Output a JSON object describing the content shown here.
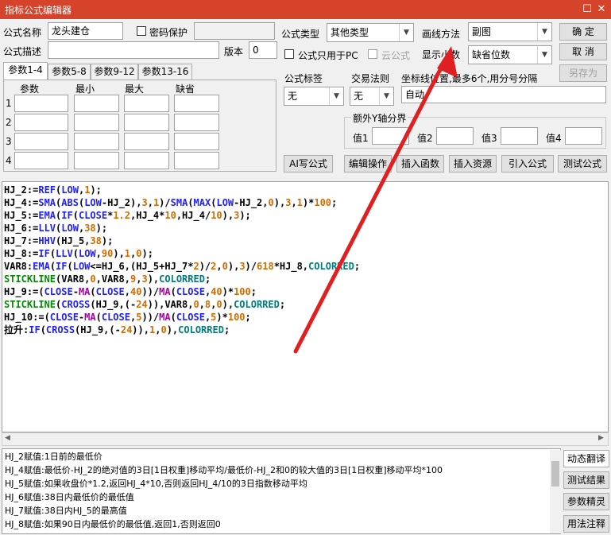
{
  "window": {
    "title": "指标公式编辑器",
    "restore_glyph": "☐",
    "close_glyph": "✕"
  },
  "form": {
    "name_label": "公式名称",
    "name_value": "龙头建仓",
    "password_label": "密码保护",
    "desc_label": "公式描述",
    "desc_value": "",
    "version_label": "版本",
    "version_value": "0",
    "type_label": "公式类型",
    "type_value": "其他类型",
    "draw_label": "画线方法",
    "draw_value": "副图",
    "pc_only_label": "公式只用于PC",
    "cloud_label": "云公式",
    "decimal_label": "显示小数",
    "decimal_value": "缺省位数",
    "formula_tag_label": "公式标签",
    "formula_tag_value": "无",
    "trade_rule_label": "交易法则",
    "trade_rule_value": "无",
    "axis_label": "坐标线位置,最多6个,用分号分隔",
    "axis_value": "自动",
    "extra_y_label": "额外Y轴分界",
    "val1_label": "值1",
    "val2_label": "值2",
    "val3_label": "值3",
    "val4_label": "值4"
  },
  "buttons": {
    "ok": "确  定",
    "cancel": "取  消",
    "save_as": "另存为",
    "ai_write": "AI写公式",
    "edit_ops": "编辑操作",
    "insert_func": "插入函数",
    "insert_res": "插入资源",
    "import": "引入公式",
    "test": "测试公式",
    "dyn_translate": "动态翻译",
    "test_result": "测试结果",
    "param_wizard": "参数精灵",
    "usage": "用法注释"
  },
  "tabs": [
    "参数1-4",
    "参数5-8",
    "参数9-12",
    "参数13-16"
  ],
  "params": {
    "headers": [
      "参数",
      "最小",
      "最大",
      "缺省"
    ],
    "rows": [
      "1",
      "2",
      "3",
      "4"
    ]
  },
  "code_lines": [
    [
      [
        "HJ_2:=",
        "k-black"
      ],
      [
        "REF",
        "k-blue"
      ],
      [
        "(",
        "k-black"
      ],
      [
        "LOW",
        "k-blue"
      ],
      [
        ",",
        "k-black"
      ],
      [
        "1",
        "k-org"
      ],
      [
        ");",
        "k-black"
      ]
    ],
    [
      [
        "HJ_4:=",
        "k-black"
      ],
      [
        "SMA",
        "k-blue"
      ],
      [
        "(",
        "k-black"
      ],
      [
        "ABS",
        "k-blue"
      ],
      [
        "(",
        "k-black"
      ],
      [
        "LOW",
        "k-blue"
      ],
      [
        "-HJ_2),",
        "k-black"
      ],
      [
        "3",
        "k-org"
      ],
      [
        ",",
        "k-black"
      ],
      [
        "1",
        "k-org"
      ],
      [
        ")/",
        "k-black"
      ],
      [
        "SMA",
        "k-blue"
      ],
      [
        "(",
        "k-black"
      ],
      [
        "MAX",
        "k-blue"
      ],
      [
        "(",
        "k-black"
      ],
      [
        "LOW",
        "k-blue"
      ],
      [
        "-HJ_2,",
        "k-black"
      ],
      [
        "0",
        "k-org"
      ],
      [
        "),",
        "k-black"
      ],
      [
        "3",
        "k-org"
      ],
      [
        ",",
        "k-black"
      ],
      [
        "1",
        "k-org"
      ],
      [
        ")*",
        "k-black"
      ],
      [
        "100",
        "k-org"
      ],
      [
        ";",
        "k-black"
      ]
    ],
    [
      [
        "HJ_5:=",
        "k-black"
      ],
      [
        "EMA",
        "k-blue"
      ],
      [
        "(",
        "k-black"
      ],
      [
        "IF",
        "k-blue"
      ],
      [
        "(",
        "k-black"
      ],
      [
        "CLOSE",
        "k-blue"
      ],
      [
        "*",
        "k-black"
      ],
      [
        "1.2",
        "k-org"
      ],
      [
        ",HJ_4*",
        "k-black"
      ],
      [
        "10",
        "k-org"
      ],
      [
        ",HJ_4/",
        "k-black"
      ],
      [
        "10",
        "k-org"
      ],
      [
        "),",
        "k-black"
      ],
      [
        "3",
        "k-org"
      ],
      [
        ");",
        "k-black"
      ]
    ],
    [
      [
        "HJ_6:=",
        "k-black"
      ],
      [
        "LLV",
        "k-blue"
      ],
      [
        "(",
        "k-black"
      ],
      [
        "LOW",
        "k-blue"
      ],
      [
        ",",
        "k-black"
      ],
      [
        "38",
        "k-org"
      ],
      [
        ");",
        "k-black"
      ]
    ],
    [
      [
        "HJ_7:=",
        "k-black"
      ],
      [
        "HHV",
        "k-blue"
      ],
      [
        "(HJ_5,",
        "k-black"
      ],
      [
        "38",
        "k-org"
      ],
      [
        ");",
        "k-black"
      ]
    ],
    [
      [
        "HJ_8:=",
        "k-black"
      ],
      [
        "IF",
        "k-blue"
      ],
      [
        "(",
        "k-black"
      ],
      [
        "LLV",
        "k-blue"
      ],
      [
        "(",
        "k-black"
      ],
      [
        "LOW",
        "k-blue"
      ],
      [
        ",",
        "k-black"
      ],
      [
        "90",
        "k-org"
      ],
      [
        "),",
        "k-black"
      ],
      [
        "1",
        "k-org"
      ],
      [
        ",",
        "k-black"
      ],
      [
        "0",
        "k-org"
      ],
      [
        ");",
        "k-black"
      ]
    ],
    [
      [
        "VAR8:",
        "k-black"
      ],
      [
        "EMA",
        "k-blue"
      ],
      [
        "(",
        "k-black"
      ],
      [
        "IF",
        "k-blue"
      ],
      [
        "(",
        "k-black"
      ],
      [
        "LOW",
        "k-blue"
      ],
      [
        "<=HJ_6,(HJ_5+HJ_7*",
        "k-black"
      ],
      [
        "2",
        "k-org"
      ],
      [
        ")/",
        "k-black"
      ],
      [
        "2",
        "k-org"
      ],
      [
        ",",
        "k-black"
      ],
      [
        "0",
        "k-org"
      ],
      [
        "),",
        "k-black"
      ],
      [
        "3",
        "k-org"
      ],
      [
        ")/",
        "k-black"
      ],
      [
        "618",
        "k-org"
      ],
      [
        "*HJ_8,",
        "k-black"
      ],
      [
        "COLORRED",
        "k-teal"
      ],
      [
        ";",
        "k-black"
      ]
    ],
    [
      [
        "STICKLINE",
        "k-green"
      ],
      [
        "(VAR8,",
        "k-black"
      ],
      [
        "0",
        "k-org"
      ],
      [
        ",VAR8,",
        "k-black"
      ],
      [
        "9",
        "k-org"
      ],
      [
        ",",
        "k-black"
      ],
      [
        "3",
        "k-org"
      ],
      [
        "),",
        "k-black"
      ],
      [
        "COLORRED",
        "k-teal"
      ],
      [
        ";",
        "k-black"
      ]
    ],
    [
      [
        "HJ_9:=(",
        "k-black"
      ],
      [
        "CLOSE",
        "k-blue"
      ],
      [
        "-",
        "k-black"
      ],
      [
        "MA",
        "k-pur"
      ],
      [
        "(",
        "k-black"
      ],
      [
        "CLOSE",
        "k-blue"
      ],
      [
        ",",
        "k-black"
      ],
      [
        "40",
        "k-org"
      ],
      [
        "))/",
        "k-black"
      ],
      [
        "MA",
        "k-pur"
      ],
      [
        "(",
        "k-black"
      ],
      [
        "CLOSE",
        "k-blue"
      ],
      [
        ",",
        "k-black"
      ],
      [
        "40",
        "k-org"
      ],
      [
        ")*",
        "k-black"
      ],
      [
        "100",
        "k-org"
      ],
      [
        ";",
        "k-black"
      ]
    ],
    [
      [
        "STICKLINE",
        "k-green"
      ],
      [
        "(",
        "k-black"
      ],
      [
        "CROSS",
        "k-blue"
      ],
      [
        "(HJ_9,(-",
        "k-black"
      ],
      [
        "24",
        "k-org"
      ],
      [
        ")),VAR8,",
        "k-black"
      ],
      [
        "0",
        "k-org"
      ],
      [
        ",",
        "k-black"
      ],
      [
        "8",
        "k-org"
      ],
      [
        ",",
        "k-black"
      ],
      [
        "0",
        "k-org"
      ],
      [
        "),",
        "k-black"
      ],
      [
        "COLORRED",
        "k-teal"
      ],
      [
        ";",
        "k-black"
      ]
    ],
    [
      [
        "HJ_10:=(",
        "k-black"
      ],
      [
        "CLOSE",
        "k-blue"
      ],
      [
        "-",
        "k-black"
      ],
      [
        "MA",
        "k-pur"
      ],
      [
        "(",
        "k-black"
      ],
      [
        "CLOSE",
        "k-blue"
      ],
      [
        ",",
        "k-black"
      ],
      [
        "5",
        "k-org"
      ],
      [
        "))/",
        "k-black"
      ],
      [
        "MA",
        "k-pur"
      ],
      [
        "(",
        "k-black"
      ],
      [
        "CLOSE",
        "k-blue"
      ],
      [
        ",",
        "k-black"
      ],
      [
        "5",
        "k-org"
      ],
      [
        ")*",
        "k-black"
      ],
      [
        "100",
        "k-org"
      ],
      [
        ";",
        "k-black"
      ]
    ],
    [
      [
        "拉升:",
        "k-black"
      ],
      [
        "IF",
        "k-blue"
      ],
      [
        "(",
        "k-black"
      ],
      [
        "CROSS",
        "k-blue"
      ],
      [
        "(HJ_9,(-",
        "k-black"
      ],
      [
        "24",
        "k-org"
      ],
      [
        ")),",
        "k-black"
      ],
      [
        "1",
        "k-org"
      ],
      [
        ",",
        "k-black"
      ],
      [
        "0",
        "k-org"
      ],
      [
        "),",
        "k-black"
      ],
      [
        "COLORRED",
        "k-teal"
      ],
      [
        ";",
        "k-black"
      ]
    ]
  ],
  "info_lines": [
    "HJ_2赋值:1日前的最低价",
    "HJ_4赋值:最低价-HJ_2的绝对值的3日[1日权重]移动平均/最低价-HJ_2和0的较大值的3日[1日权重]移动平均*100",
    "HJ_5赋值:如果收盘价*1.2,返回HJ_4*10,否则返回HJ_4/10的3日指数移动平均",
    "HJ_6赋值:38日内最低价的最低值",
    "HJ_7赋值:38日内HJ_5的最高值",
    "HJ_8赋值:如果90日内最低价的最低值,返回1,否则返回0"
  ],
  "colors": {
    "title_bar": "#d6432b",
    "arrow": "#e02020"
  }
}
